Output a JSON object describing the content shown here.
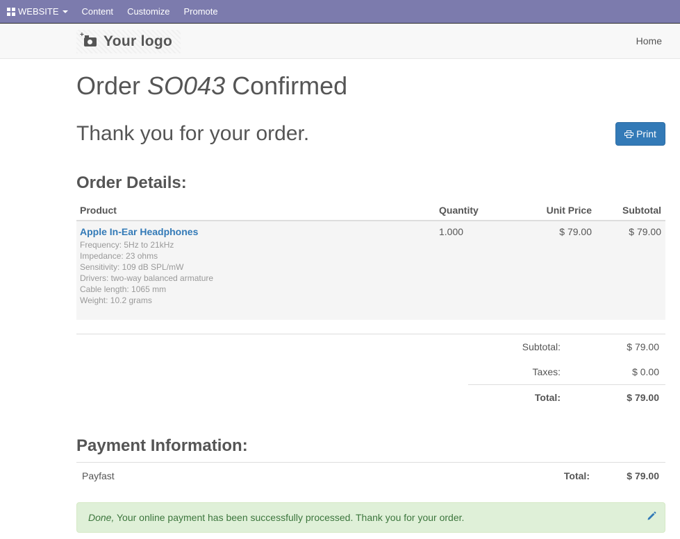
{
  "adminbar": {
    "website_label": "WEBSITE",
    "menu": [
      "Content",
      "Customize",
      "Promote"
    ]
  },
  "navbar": {
    "logo_text": "Your logo",
    "home_label": "Home"
  },
  "order": {
    "title_prefix": "Order",
    "number": "SO043",
    "title_suffix": "Confirmed",
    "thanks": "Thank you for your order.",
    "print_label": "Print"
  },
  "details": {
    "heading": "Order Details:",
    "columns": {
      "product": "Product",
      "quantity": "Quantity",
      "unit_price": "Unit Price",
      "subtotal": "Subtotal"
    },
    "line": {
      "name": "Apple In-Ear Headphones",
      "description": [
        "Frequency: 5Hz to 21kHz",
        "Impedance: 23 ohms",
        "Sensitivity: 109 dB SPL/mW",
        "Drivers: two-way balanced armature",
        "Cable length: 1065 mm",
        "Weight: 10.2 grams"
      ],
      "quantity": "1.000",
      "unit_price": "$ 79.00",
      "subtotal": "$ 79.00"
    }
  },
  "totals": {
    "subtotal_label": "Subtotal:",
    "subtotal_value": "$ 79.00",
    "taxes_label": "Taxes:",
    "taxes_value": "$ 0.00",
    "total_label": "Total:",
    "total_value": "$ 79.00"
  },
  "payment": {
    "heading": "Payment Information:",
    "method": "Payfast",
    "total_label": "Total:",
    "total_value": "$ 79.00",
    "status_em": "Done,",
    "status_text": " Your online payment has been successfully processed. Thank you for your order."
  },
  "colors": {
    "adminbar": "#7c7bad",
    "primary": "#337ab7",
    "success_bg": "#dff0d8",
    "success_text": "#3c763d"
  },
  "icons": [
    "apps-grid-icon",
    "caret-down-icon",
    "camera-icon",
    "print-icon",
    "pencil-icon"
  ]
}
